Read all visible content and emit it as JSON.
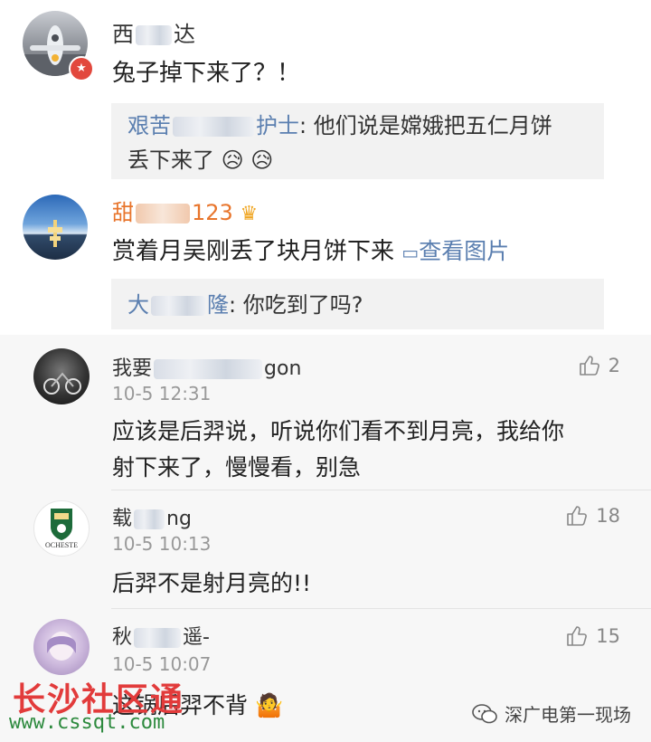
{
  "comments": [
    {
      "name": "西",
      "name_suffix": "达",
      "content": "兔子掉下来了？！",
      "reply": {
        "author": "艰苦",
        "author_suffix": "护士",
        "text_line1": "他们说是嫦娥把五仁月饼",
        "text_line2": "丢下来了"
      }
    },
    {
      "name": "甜",
      "name_suffix": "123",
      "content": "赏着月吴刚丢了块月饼下来",
      "view_image": "查看图片",
      "reply": {
        "author": "大",
        "author_suffix": "隆",
        "text": "你吃到了吗?"
      }
    }
  ],
  "hot_comments": [
    {
      "name": "我要",
      "name_suffix": "gon",
      "time": "10-5 12:31",
      "likes": "2",
      "content_line1": "应该是后羿说，听说你们看不到月亮，我给你",
      "content_line2": "射下来了，慢慢看，别急"
    },
    {
      "name": "载",
      "name_suffix": "ng",
      "time": "10-5 10:13",
      "likes": "18",
      "avatar_text": "OCHESTE",
      "content_line1": "后羿不是射月亮的!!"
    },
    {
      "name": "秋",
      "name_suffix": "遥-",
      "time": "10-5 10:07",
      "likes": "15",
      "content_line1": "这锅后羿不背"
    }
  ],
  "watermark": {
    "title": "长沙社区通",
    "url": "www.cssqt.com"
  },
  "wechat_account": "深广电第一现场"
}
